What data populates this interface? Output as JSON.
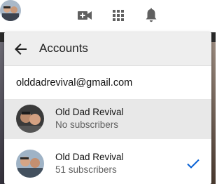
{
  "topbar": {
    "create_icon": "video-camera-plus-icon",
    "apps_icon": "apps-grid-icon",
    "notifications_icon": "bell-icon",
    "avatar_icon": "account-avatar"
  },
  "menu": {
    "title": "Accounts",
    "back_icon": "arrow-back-icon",
    "email": "olddadrevival@gmail.com",
    "accounts": [
      {
        "name": "Old Dad Revival",
        "subscribers": "No subscribers",
        "selected": false
      },
      {
        "name": "Old Dad Revival",
        "subscribers": "51 subscribers",
        "selected": true
      }
    ],
    "check_icon": "checkmark-icon",
    "accent_color": "#065fd4"
  }
}
